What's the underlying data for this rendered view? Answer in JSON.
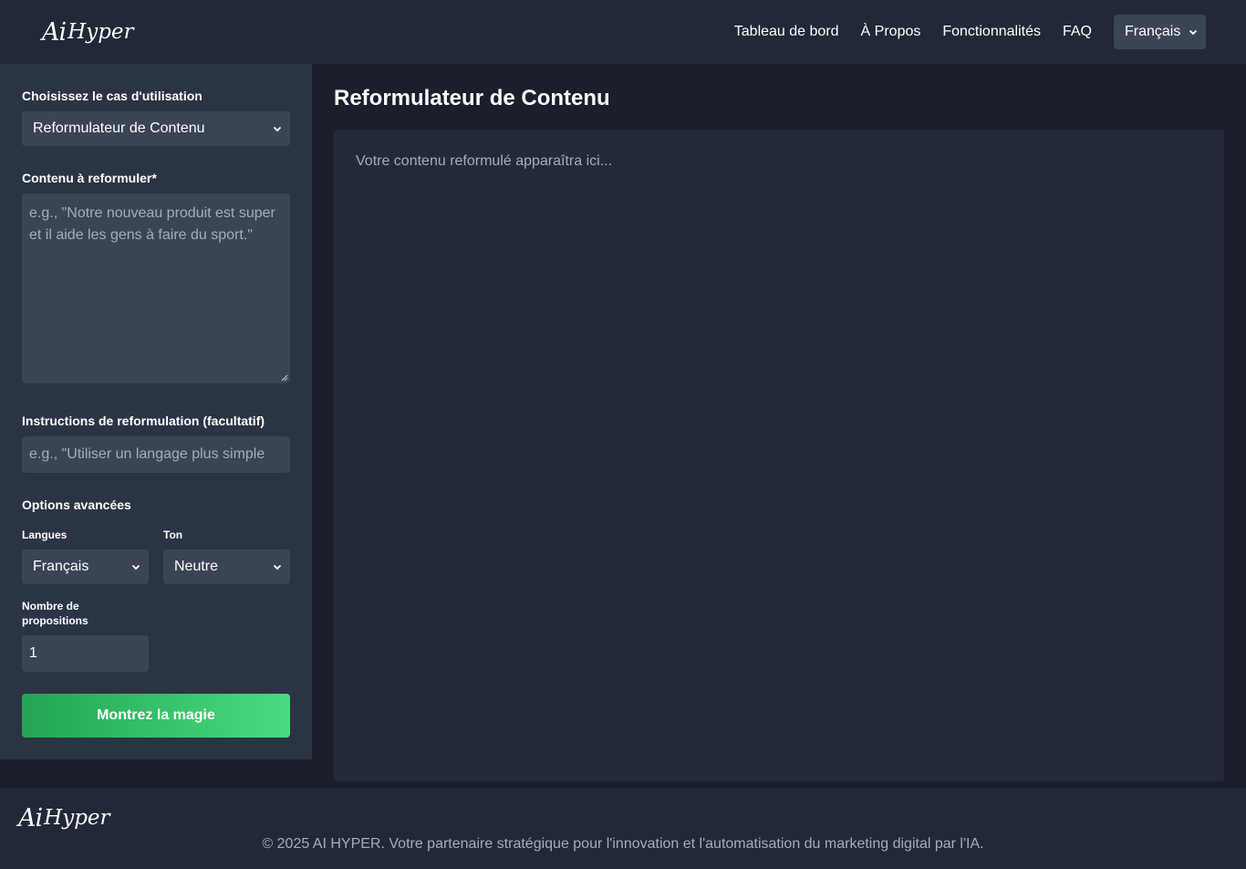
{
  "header": {
    "logo_mark": "Ai",
    "logo_text": "Hyper",
    "nav": [
      {
        "label": "Tableau de bord"
      },
      {
        "label": "À Propos"
      },
      {
        "label": "Fonctionnalités"
      },
      {
        "label": "FAQ"
      }
    ],
    "language": "Français"
  },
  "sidebar": {
    "use_case_label": "Choisissez le cas d'utilisation",
    "use_case_value": "Reformulateur de Contenu",
    "content_label": "Contenu à reformuler*",
    "content_placeholder": "e.g., \"Notre nouveau produit est super et il aide les gens à faire du sport.\"",
    "instructions_label": "Instructions de reformulation (facultatif)",
    "instructions_placeholder": "e.g., \"Utiliser un langage plus simple",
    "advanced_label": "Options avancées",
    "languages_label": "Langues",
    "languages_value": "Français",
    "tone_label": "Ton",
    "tone_value": "Neutre",
    "proposals_label": "Nombre de propositions",
    "proposals_value": "1",
    "submit_label": "Montrez la magie"
  },
  "main": {
    "title": "Reformulateur de Contenu",
    "output_placeholder": "Votre contenu reformulé apparaîtra ici..."
  },
  "footer": {
    "logo_mark": "Ai",
    "logo_text": "Hyper",
    "copyright": "© 2025 AI HYPER. Votre partenaire stratégique pour l'innovation et l'automatisation du marketing digital par l'IA."
  },
  "colors": {
    "background": "#1a1f2b",
    "header": "#212938",
    "sidebar": "#2b3445",
    "field": "#3a4455",
    "accent_start": "#22a552",
    "accent_end": "#49dc80"
  }
}
